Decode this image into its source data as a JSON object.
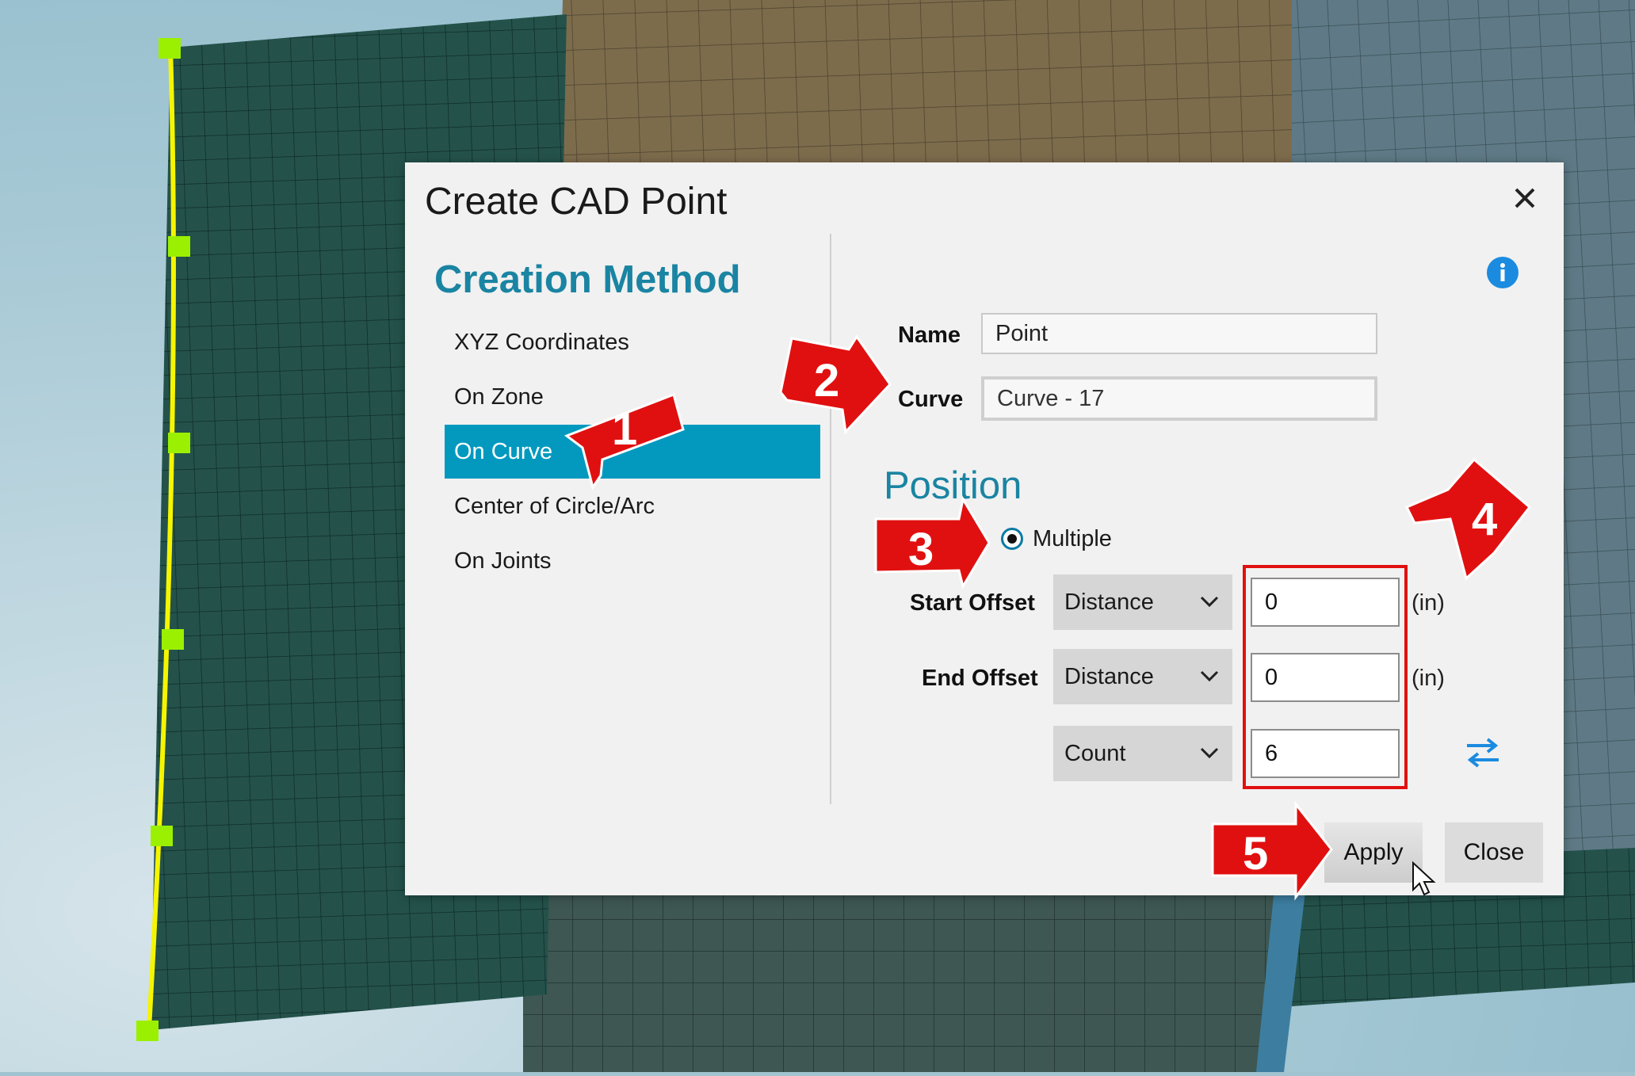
{
  "dialog": {
    "title": "Create CAD Point",
    "close_label": "Close dialog"
  },
  "creation_method": {
    "title": "Creation Method",
    "items": [
      {
        "label": "XYZ Coordinates",
        "selected": false
      },
      {
        "label": "On Zone",
        "selected": false
      },
      {
        "label": "On Curve",
        "selected": true
      },
      {
        "label": "Center of Circle/Arc",
        "selected": false
      },
      {
        "label": "On Joints",
        "selected": false
      }
    ]
  },
  "fields": {
    "name_label": "Name",
    "name_value": "Point",
    "curve_label": "Curve",
    "curve_value": "Curve - 17"
  },
  "position": {
    "title": "Position",
    "mode_label": "Multiple",
    "rows": [
      {
        "label": "Start Offset",
        "type": "Distance",
        "value": "0",
        "unit": "(in)"
      },
      {
        "label": "End Offset",
        "type": "Distance",
        "value": "0",
        "unit": "(in)"
      },
      {
        "label": "",
        "type": "Count",
        "value": "6",
        "unit": ""
      }
    ]
  },
  "buttons": {
    "apply": "Apply",
    "close": "Close"
  },
  "annotations": [
    "1",
    "2",
    "3",
    "4",
    "5"
  ],
  "colors": {
    "accent": "#0399bf",
    "title_teal": "#1a84a2",
    "annotation_red": "#e11010",
    "curve_yellow": "#f5f500",
    "info_blue": "#1b8be0"
  },
  "icons": [
    "close-icon",
    "info-icon",
    "chevron-down-icon",
    "swap-direction-icon",
    "mouse-cursor-icon"
  ]
}
